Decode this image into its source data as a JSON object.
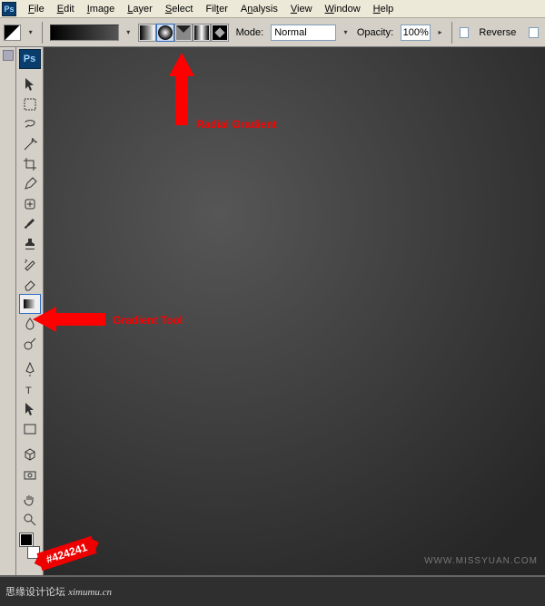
{
  "app_icon": "Ps",
  "menu": [
    "File",
    "Edit",
    "Image",
    "Layer",
    "Select",
    "Filter",
    "Analysis",
    "View",
    "Window",
    "Help"
  ],
  "optbar": {
    "mode_label": "Mode:",
    "mode_value": "Normal",
    "opacity_label": "Opacity:",
    "opacity_value": "100%",
    "reverse_label": "Reverse"
  },
  "annotations": {
    "radial": "Radial Gradient",
    "gradtool": "Gradient Tool",
    "hex": "#424241"
  },
  "watermark": "WWW.MISSYUAN.COM",
  "bottom_domain": "ximumu.cn",
  "tools_badge": "Ps"
}
